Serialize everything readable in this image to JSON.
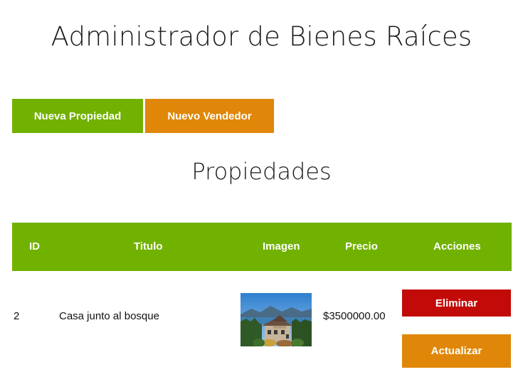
{
  "header": {
    "title": "Administrador de Bienes Raíces"
  },
  "toolbar": {
    "new_property_label": "Nueva Propiedad",
    "new_seller_label": "Nuevo Vendedor"
  },
  "section": {
    "title": "Propiedades"
  },
  "table": {
    "columns": [
      "ID",
      "Titulo",
      "Imagen",
      "Precio",
      "Acciones"
    ],
    "rows": [
      {
        "id": "2",
        "title": "Casa junto al bosque",
        "image_icon": "house-lake-photo",
        "price": "$3500000.00",
        "delete_label": "Eliminar",
        "update_label": "Actualizar"
      }
    ]
  },
  "colors": {
    "green": "#71b100",
    "orange": "#e08709",
    "red": "#c20b09"
  }
}
